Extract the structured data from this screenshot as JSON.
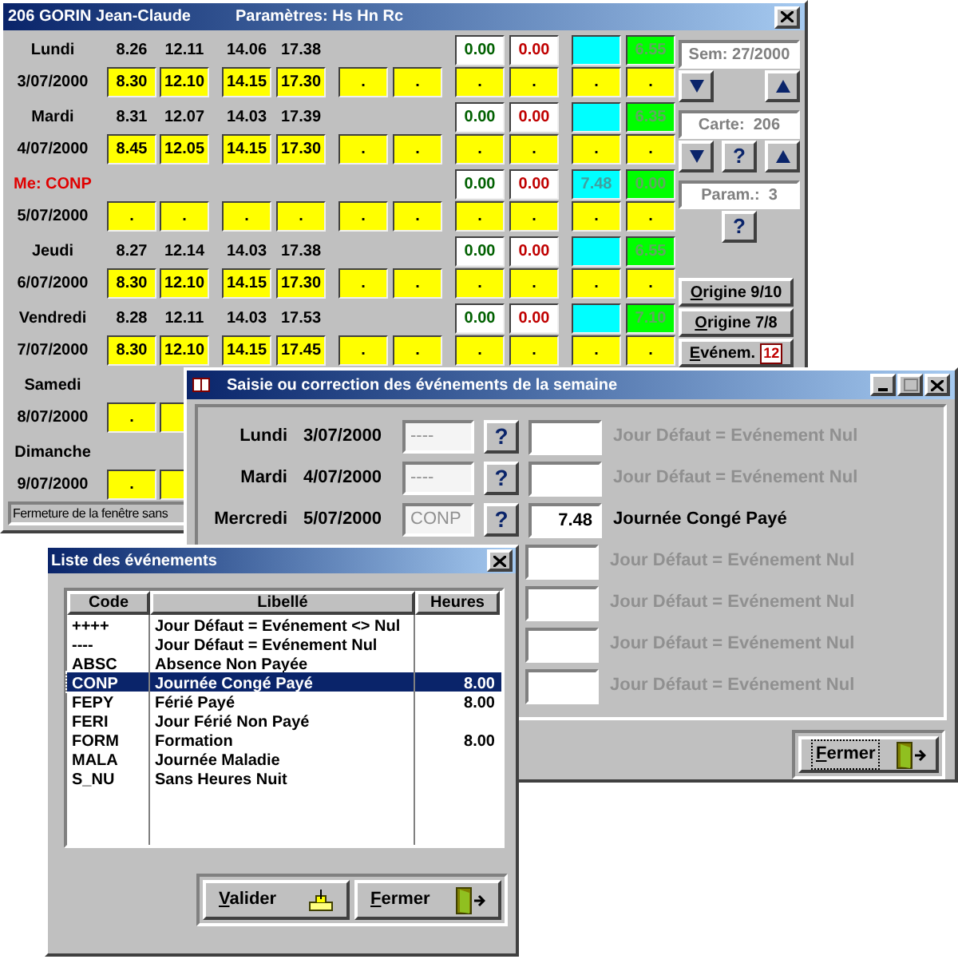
{
  "main_window": {
    "title": "206 GORIN Jean-Claude",
    "subtitle": "Paramètres: Hs Hn Rc",
    "days": [
      {
        "kind": "normal",
        "name": "Lundi",
        "date": "3/07/2000",
        "times": [
          "8.26",
          "12.11",
          "14.06",
          "17.38"
        ],
        "status": {
          "regular": "0.00",
          "overtime": "0.00",
          "total": "6.55"
        },
        "cells": [
          "8.30",
          "12.10",
          "14.15",
          "17.30",
          ".",
          ".",
          ".",
          ".",
          ".",
          "."
        ]
      },
      {
        "kind": "normal",
        "name": "Mardi",
        "date": "4/07/2000",
        "times": [
          "8.31",
          "12.07",
          "14.03",
          "17.39"
        ],
        "status": {
          "regular": "0.00",
          "overtime": "0.00",
          "total": "6.35"
        },
        "cells": [
          "8.45",
          "12.05",
          "14.15",
          "17.30",
          ".",
          ".",
          ".",
          ".",
          ".",
          "."
        ]
      },
      {
        "kind": "event",
        "name": "Me: CONP",
        "date": "5/07/2000",
        "status": {
          "regular": "0.00",
          "overtime": "0.00",
          "event": "7.48",
          "total": "0.00"
        },
        "cells": [
          ".",
          ".",
          ".",
          ".",
          ".",
          ".",
          ".",
          ".",
          ".",
          "."
        ]
      },
      {
        "kind": "normal",
        "name": "Jeudi",
        "date": "6/07/2000",
        "times": [
          "8.27",
          "12.14",
          "14.03",
          "17.38"
        ],
        "status": {
          "regular": "0.00",
          "overtime": "0.00",
          "total": "6.55"
        },
        "cells": [
          "8.30",
          "12.10",
          "14.15",
          "17.30",
          ".",
          ".",
          ".",
          ".",
          ".",
          "."
        ]
      },
      {
        "kind": "normal",
        "name": "Vendredi",
        "date": "7/07/2000",
        "times": [
          "8.28",
          "12.11",
          "14.03",
          "17.53"
        ],
        "status": {
          "regular": "0.00",
          "overtime": "0.00",
          "total": "7.10"
        },
        "cells": [
          "8.30",
          "12.10",
          "14.15",
          "17.45",
          ".",
          ".",
          ".",
          ".",
          ".",
          "."
        ]
      },
      {
        "kind": "normal",
        "name": "Samedi",
        "date": "8/07/2000",
        "cells": [
          ".",
          null
        ]
      },
      {
        "kind": "normal",
        "name": "Dimanche",
        "date": "9/07/2000",
        "cells": [
          ".",
          null
        ]
      }
    ],
    "side_panel": {
      "week": "Sem: 27/2000",
      "card": "Carte:  206",
      "card_help": "?",
      "params": "Param.:  3",
      "params_help": "?"
    },
    "buttons": [
      "Origine 9/10",
      "Origine 7/8"
    ],
    "event_button": {
      "label": "Evénem.",
      "badge": "12"
    },
    "status_bar": "Fermeture de la fenêtre sans"
  },
  "week_dialog": {
    "title": "Saisie ou correction des événements de la semaine",
    "rows": [
      {
        "day": "Lundi",
        "date": "3/07/2000",
        "code": "----",
        "help": "?",
        "label": "Jour Défaut = Evénement Nul",
        "active": false
      },
      {
        "day": "Mardi",
        "date": "4/07/2000",
        "code": "----",
        "help": "?",
        "label": "Jour Défaut = Evénement Nul",
        "active": false
      },
      {
        "day": "Mercredi",
        "date": "5/07/2000",
        "code": "CONP",
        "help": "?",
        "hours": "7.48",
        "label": "Journée Congé Payé",
        "active": true
      },
      {
        "label": "Jour Défaut = Evénement Nul",
        "active": false
      },
      {
        "label": "Jour Défaut = Evénement Nul",
        "active": false
      },
      {
        "label": "Jour Défaut = Evénement Nul",
        "active": false
      },
      {
        "label": "Jour Défaut = Evénement Nul",
        "active": false
      }
    ],
    "close_button": "Fermer"
  },
  "list_dialog": {
    "title": "Liste des événements",
    "columns": [
      "Code",
      "Libellé",
      "Heures"
    ],
    "rows": [
      {
        "code": "++++",
        "label": "Jour Défaut = Evénement <> Nul",
        "selected": false
      },
      {
        "code": "----",
        "label": "Jour Défaut = Evénement Nul",
        "selected": false
      },
      {
        "code": "ABSC",
        "label": "Absence Non Payée",
        "selected": false
      },
      {
        "code": "CONP",
        "label": "Journée Congé Payé",
        "hours": "8.00",
        "selected": true
      },
      {
        "code": "FEPY",
        "label": "Férié Payé",
        "hours": "8.00",
        "selected": false
      },
      {
        "code": "FERI",
        "label": "Jour Férié Non Payé",
        "selected": false
      },
      {
        "code": "FORM",
        "label": "Formation",
        "hours": "8.00",
        "selected": false
      },
      {
        "code": "MALA",
        "label": "Journée Maladie",
        "selected": false
      },
      {
        "code": "S_NU",
        "label": "Sans Heures Nuit",
        "selected": false
      }
    ],
    "buttons": [
      "Valider",
      "Fermer"
    ]
  }
}
